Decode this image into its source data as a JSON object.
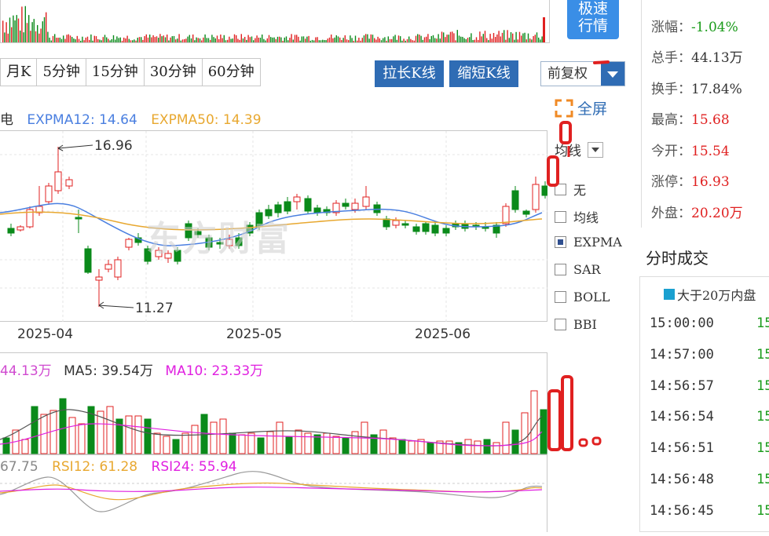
{
  "speed_button": {
    "line1": "极速",
    "line2": "行情"
  },
  "period_tabs": [
    "月K",
    "5分钟",
    "15分钟",
    "30分钟",
    "60分钟"
  ],
  "buttons": {
    "lengthen": "拉长K线",
    "shorten": "缩短K线"
  },
  "adjust_select": {
    "value": "前复权"
  },
  "fullscreen": {
    "label": "全屏"
  },
  "legend_main": {
    "name_tail": "电",
    "ema12": "EXPMA12: 14.64",
    "ema50": "EXPMA50: 14.39",
    "ema12_color": "#4a7fe0",
    "ema50_color": "#e8a830"
  },
  "annotations": {
    "high": "16.96",
    "low": "11.27"
  },
  "x_labels": [
    "2025-04",
    "2025-05",
    "2025-06"
  ],
  "watermark": "东方财富",
  "indicator_panel": {
    "header": "均线",
    "items": [
      {
        "label": "无",
        "checked": false
      },
      {
        "label": "均线",
        "checked": false
      },
      {
        "label": "EXPMA",
        "checked": true
      },
      {
        "label": "SAR",
        "checked": false
      },
      {
        "label": "BOLL",
        "checked": false
      },
      {
        "label": "BBI",
        "checked": false
      }
    ]
  },
  "legend_volume": {
    "vol": "44.13万",
    "ma5": "MA5: 39.54万",
    "ma10": "MA10: 23.33万"
  },
  "legend_rsi": {
    "rsi6": "67.75",
    "rsi12": "RSI12: 61.28",
    "rsi24": "RSI24: 55.94"
  },
  "info_panel": [
    {
      "label": "涨幅：",
      "value": "-1.04%",
      "color": "#1a9b1a"
    },
    {
      "label": "总手：",
      "value": "44.13万",
      "color": "#333333"
    },
    {
      "label": "换手：",
      "value": "17.84%",
      "color": "#333333"
    },
    {
      "label": "最高：",
      "value": "15.68",
      "color": "#e02020"
    },
    {
      "label": "今开：",
      "value": "15.54",
      "color": "#e02020"
    },
    {
      "label": "涨停：",
      "value": "16.93",
      "color": "#e02020"
    },
    {
      "label": "外盘：",
      "value": "20.20万",
      "color": "#e02020"
    }
  ],
  "ticks": {
    "title": "分时成交",
    "filter_label": "大于20万内盘",
    "rows": [
      {
        "time": "15:00:00",
        "price": "15"
      },
      {
        "time": "14:57:00",
        "price": "15"
      },
      {
        "time": "14:56:57",
        "price": "15"
      },
      {
        "time": "14:56:54",
        "price": "15"
      },
      {
        "time": "14:56:51",
        "price": "15"
      },
      {
        "time": "14:56:48",
        "price": "15"
      },
      {
        "time": "14:56:45",
        "price": "15"
      }
    ]
  },
  "colors": {
    "up": "#e02020",
    "down": "#0a8a1a",
    "accent": "#2f6cb4"
  }
}
